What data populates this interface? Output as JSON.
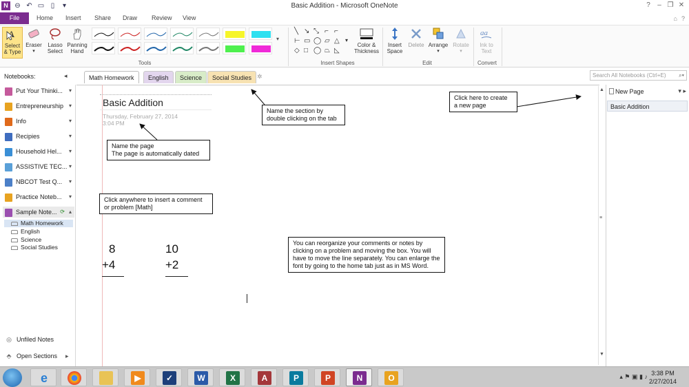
{
  "window": {
    "title": "Basic Addition - Microsoft OneNote"
  },
  "ribbon_tabs": [
    "File",
    "Home",
    "Insert",
    "Share",
    "Draw",
    "Review",
    "View"
  ],
  "ribbon": {
    "tools": {
      "select_type": "Select & Type",
      "eraser": "Eraser",
      "lasso_select": "Lasso Select",
      "panning_hand": "Panning Hand",
      "group": "Tools"
    },
    "insert_shapes_group": "Insert Shapes",
    "color_thickness": "Color & Thickness",
    "edit": {
      "insert_space": "Insert Space",
      "delete": "Delete",
      "arrange": "Arrange",
      "rotate": "Rotate",
      "group": "Edit"
    },
    "convert": {
      "ink_to_text": "Ink to Text",
      "group": "Convert"
    }
  },
  "sections": {
    "notebooks_label": "Notebooks:",
    "tabs": [
      "Math Homework",
      "English",
      "Science",
      "Social Studies"
    ],
    "search_placeholder": "Search All Notebooks (Ctrl+E)"
  },
  "notebooks": [
    {
      "name": "Put Your Thinki...",
      "color": "#c55a9c"
    },
    {
      "name": "Entrepreneurship",
      "color": "#e8a320"
    },
    {
      "name": "Info",
      "color": "#e06a1b"
    },
    {
      "name": "Recipies",
      "color": "#3f6dbf"
    },
    {
      "name": "Household Hel...",
      "color": "#3a8fd6"
    },
    {
      "name": "ASSISTIVE TEC...",
      "color": "#5aa0d8"
    },
    {
      "name": "NBCOT Test Q...",
      "color": "#4c80c8"
    },
    {
      "name": "Practice Noteb...",
      "color": "#e8a320"
    },
    {
      "name": "Sample Note...",
      "color": "#9b4fb0"
    }
  ],
  "open_notebook_sections": [
    "Math Homework",
    "English",
    "Science",
    "Social Studies"
  ],
  "bottom_links": {
    "unfiled": "Unfiled Notes",
    "open_sections": "Open Sections"
  },
  "page": {
    "title": "Basic Addition",
    "date": "Thursday, February 27, 2014",
    "time": "3:04 PM"
  },
  "notes": {
    "name_page": "Name the page\nThe page is automatically dated",
    "name_section": "Name the section by double clicking on the tab",
    "create_page": "Click here to create a new page",
    "insert_comment": "Click anywhere to insert a comment or problem [Math]",
    "reorganize": "You can reorganize your comments or notes by clicking on a problem and moving the box.  You will have to move the line separately.  You can enlarge the font by going to the home tab just as in MS Word."
  },
  "math": {
    "p1_top": "8",
    "p1_bottom": "+4",
    "p2_top": "10",
    "p2_bottom": "+2"
  },
  "page_pane": {
    "new_page": "New Page",
    "items": [
      "Basic Addition"
    ]
  },
  "taskbar": {
    "time": "3:38 PM",
    "date": "2/27/2014"
  }
}
